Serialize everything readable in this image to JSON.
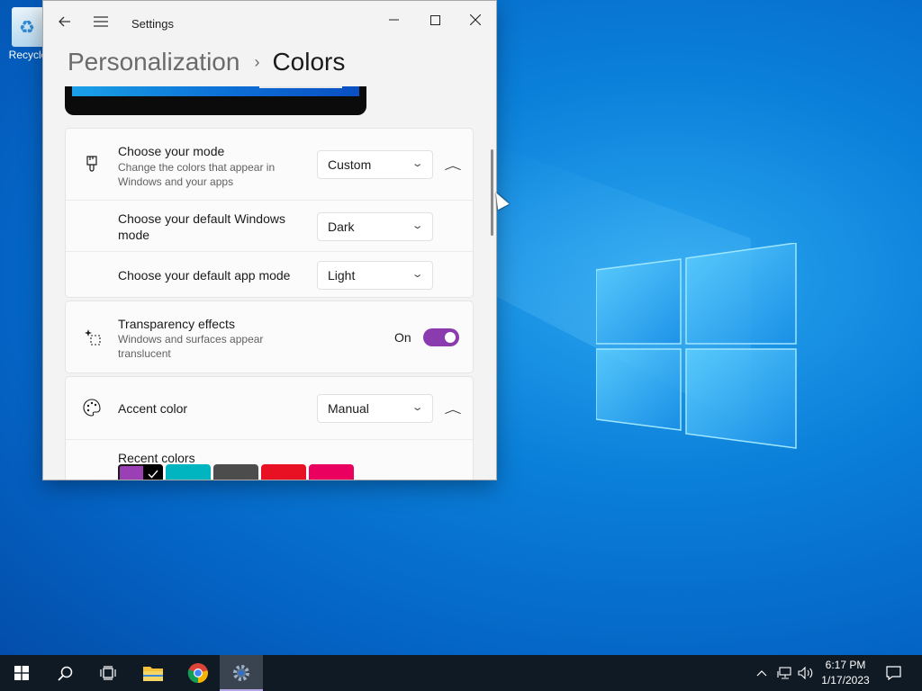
{
  "desktop": {
    "recycle_bin_label": "Recycle"
  },
  "window": {
    "app_title": "Settings",
    "breadcrumb_parent": "Personalization",
    "breadcrumb_separator": "›",
    "breadcrumb_current": "Colors"
  },
  "mode_card": {
    "title": "Choose your mode",
    "subtitle_line1": "Change the colors that appear in",
    "subtitle_line2": "Windows and your apps",
    "value": "Custom",
    "default_windows_mode_label_line1": "Choose your default Windows",
    "default_windows_mode_label_line2": "mode",
    "default_windows_mode_value": "Dark",
    "default_app_mode_label": "Choose your default app mode",
    "default_app_mode_value": "Light"
  },
  "transparency_card": {
    "title": "Transparency effects",
    "subtitle_line1": "Windows and surfaces appear",
    "subtitle_line2": "translucent",
    "state": "On",
    "on": true
  },
  "accent_card": {
    "title": "Accent color",
    "value": "Manual",
    "recent_colors_label": "Recent colors",
    "recent_colors": [
      "#9b3fb5",
      "#00b4c0",
      "#4c4c4c",
      "#e81123",
      "#ea005e"
    ],
    "selected_index": 0
  },
  "taskbar": {
    "time": "6:17 PM",
    "date": "1/17/2023"
  },
  "colors": {
    "toggle_on": "#8a3cae",
    "taskbar_bg": "#101a24"
  }
}
